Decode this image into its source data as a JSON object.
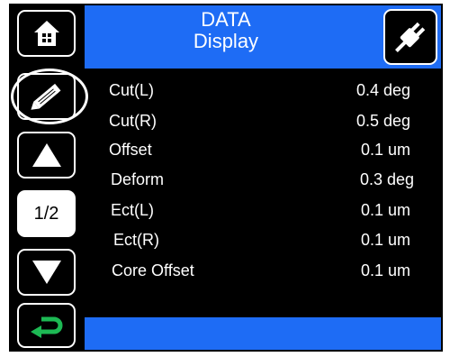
{
  "header": {
    "title_line1": "DATA",
    "title_line2": "Display"
  },
  "sidebar": {
    "home_icon": "home-icon",
    "edit_icon": "pencil-icon",
    "up_icon": "up-arrow-icon",
    "page_indicator": "1/2",
    "down_icon": "down-arrow-icon",
    "return_icon": "return-arrow-icon"
  },
  "plug_icon": "power-plug-icon",
  "rows": [
    {
      "label": "Cut(L)",
      "value": "0.4 deg"
    },
    {
      "label": "Cut(R)",
      "value": "0.5 deg"
    },
    {
      "label": "Offset",
      "value": "0.1 um"
    },
    {
      "label": "Deform",
      "value": "0.3 deg"
    },
    {
      "label": "Ect(L)",
      "value": "0.1 um"
    },
    {
      "label": "Ect(R)",
      "value": "0.1 um"
    },
    {
      "label": "Core Offset",
      "value": "0.1 um"
    }
  ],
  "colors": {
    "accent": "#1e6cf5",
    "background": "#000000",
    "return_icon": "#1db954"
  }
}
